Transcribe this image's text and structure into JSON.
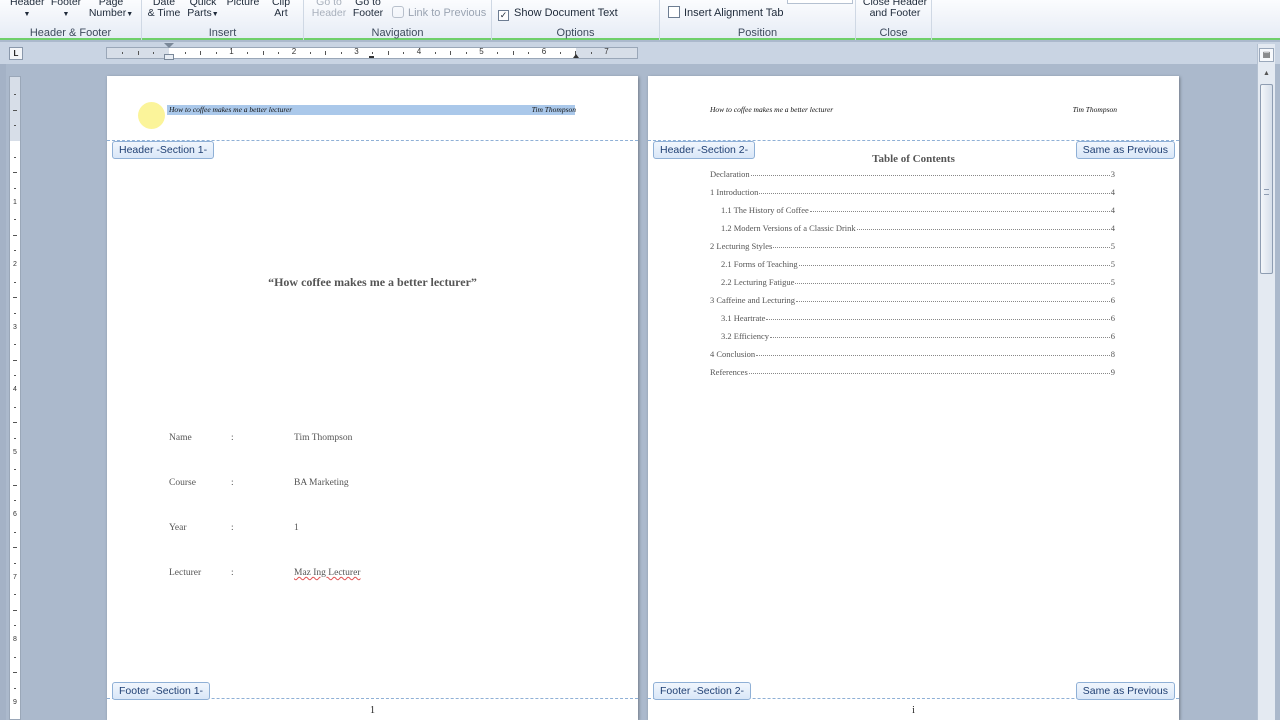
{
  "ribbon": {
    "groups": [
      {
        "label": "Header & Footer"
      },
      {
        "label": "Insert"
      },
      {
        "label": "Navigation"
      },
      {
        "label": "Options"
      },
      {
        "label": "Position"
      },
      {
        "label": "Close"
      }
    ],
    "header_btn": "Header",
    "footer_btn": "Footer",
    "page_number_l1": "Page",
    "page_number_l2": "Number",
    "date_l1": "Date",
    "date_l2": "& Time",
    "quick_l1": "Quick",
    "quick_l2": "Parts",
    "picture_btn": "Picture",
    "clip_l1": "Clip",
    "clip_l2": "Art",
    "goto_header_l1": "Go to",
    "goto_header_l2": "Header",
    "goto_footer_l1": "Go to",
    "goto_footer_l2": "Footer",
    "link_previous": "Link to Previous",
    "show_doc_text": "Show Document Text",
    "insert_align_tab": "Insert Alignment Tab",
    "close_l1": "Close Header",
    "close_l2": "and Footer"
  },
  "ruler": {
    "corner": "L",
    "numbers": [
      "1",
      "2",
      "3",
      "4",
      "5",
      "6",
      "7"
    ],
    "vnumbers": [
      "1",
      "2",
      "3",
      "4",
      "5",
      "6",
      "7",
      "8",
      "9"
    ]
  },
  "page1": {
    "header_left": "How to coffee makes me a better lecturer",
    "header_right": "Tim Thompson",
    "header_tag": "Header -Section 1-",
    "footer_tag": "Footer -Section 1-",
    "title": "“How coffee makes me a better lecturer”",
    "info": [
      {
        "label": "Name",
        "colon": ":",
        "value": "Tim Thompson"
      },
      {
        "label": "Course",
        "colon": ":",
        "value": "BA Marketing"
      },
      {
        "label": "Year",
        "colon": ":",
        "value": "1"
      },
      {
        "label": "Lecturer",
        "colon": ":",
        "value": "Maz Ing Lecturer"
      }
    ],
    "page_number": "1"
  },
  "page2": {
    "header_left": "How to coffee makes me a better lecturer",
    "header_right": "Tim Thompson",
    "header_tag": "Header -Section 2-",
    "footer_tag": "Footer -Section 2-",
    "same_as_previous": "Same as Previous",
    "toc_title": "Table of Contents",
    "toc": [
      {
        "text": "Declaration",
        "page": "3",
        "level": 1
      },
      {
        "text": "1 Introduction",
        "page": "4",
        "level": 1
      },
      {
        "text": "1.1 The History of Coffee",
        "page": "4",
        "level": 2
      },
      {
        "text": "1.2 Modern Versions of a Classic Drink",
        "page": "4",
        "level": 2
      },
      {
        "text": "2 Lecturing Styles",
        "page": "5",
        "level": 1
      },
      {
        "text": "2.1 Forms of Teaching",
        "page": "5",
        "level": 2
      },
      {
        "text": "2.2 Lecturing Fatigue",
        "page": "5",
        "level": 2
      },
      {
        "text": "3 Caffeine and Lecturing",
        "page": "6",
        "level": 1
      },
      {
        "text": "3.1 Heartrate",
        "page": "6",
        "level": 2
      },
      {
        "text": "3.2 Efficiency",
        "page": "6",
        "level": 2
      },
      {
        "text": "4 Conclusion",
        "page": "8",
        "level": 1
      },
      {
        "text": "References",
        "page": "9",
        "level": 1
      }
    ],
    "page_number": "i"
  },
  "colors": {
    "accent_green": "#6fcf6a",
    "tag_border": "#8fb0d6",
    "selection": "#aac8ea"
  }
}
